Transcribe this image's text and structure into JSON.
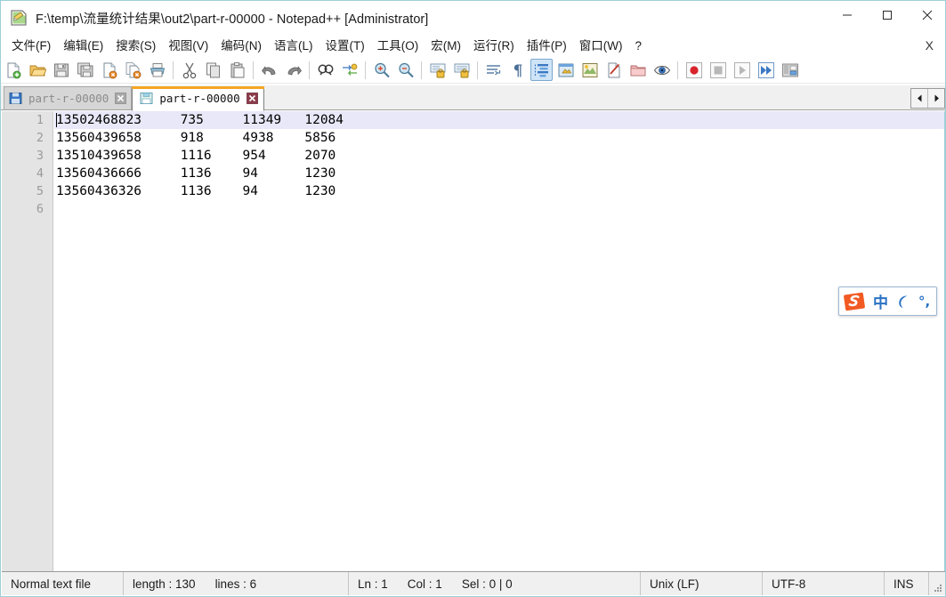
{
  "window": {
    "title": "F:\\temp\\流量统计结果\\out2\\part-r-00000 - Notepad++ [Administrator]",
    "icon": "notepad-plus-plus-icon",
    "controls": {
      "minimize": "–",
      "maximize": "□",
      "close": "✕"
    }
  },
  "menubar": {
    "items": [
      {
        "label": "文件(F)",
        "name": "menu-file"
      },
      {
        "label": "编辑(E)",
        "name": "menu-edit"
      },
      {
        "label": "搜索(S)",
        "name": "menu-search"
      },
      {
        "label": "视图(V)",
        "name": "menu-view"
      },
      {
        "label": "编码(N)",
        "name": "menu-encoding"
      },
      {
        "label": "语言(L)",
        "name": "menu-language"
      },
      {
        "label": "设置(T)",
        "name": "menu-settings"
      },
      {
        "label": "工具(O)",
        "name": "menu-tools"
      },
      {
        "label": "宏(M)",
        "name": "menu-macro"
      },
      {
        "label": "运行(R)",
        "name": "menu-run"
      },
      {
        "label": "插件(P)",
        "name": "menu-plugins"
      },
      {
        "label": "窗口(W)",
        "name": "menu-window"
      },
      {
        "label": "?",
        "name": "menu-help"
      }
    ],
    "document_close_label": "X"
  },
  "toolbar": {
    "buttons": [
      {
        "name": "new-file-icon",
        "title": "新建"
      },
      {
        "name": "open-file-icon",
        "title": "打开"
      },
      {
        "name": "save-icon",
        "title": "保存"
      },
      {
        "name": "save-all-icon",
        "title": "保存所有"
      },
      {
        "name": "close-file-icon",
        "title": "关闭"
      },
      {
        "name": "close-all-icon",
        "title": "关闭所有"
      },
      {
        "name": "print-icon",
        "title": "打印"
      },
      {
        "name": "separator-1",
        "sep": true
      },
      {
        "name": "cut-icon",
        "title": "剪切"
      },
      {
        "name": "copy-icon",
        "title": "复制"
      },
      {
        "name": "paste-icon",
        "title": "粘贴"
      },
      {
        "name": "separator-2",
        "sep": true
      },
      {
        "name": "undo-icon",
        "title": "撤销"
      },
      {
        "name": "redo-icon",
        "title": "重做"
      },
      {
        "name": "separator-3",
        "sep": true
      },
      {
        "name": "find-icon",
        "title": "查找"
      },
      {
        "name": "replace-icon",
        "title": "替换"
      },
      {
        "name": "separator-4",
        "sep": true
      },
      {
        "name": "zoom-in-icon",
        "title": "放大"
      },
      {
        "name": "zoom-out-icon",
        "title": "缩小"
      },
      {
        "name": "separator-5",
        "sep": true
      },
      {
        "name": "sync-vertical-scroll-icon",
        "title": "垂直同步滚动"
      },
      {
        "name": "sync-horizontal-scroll-icon",
        "title": "水平同步滚动"
      },
      {
        "name": "separator-6",
        "sep": true
      },
      {
        "name": "word-wrap-icon",
        "title": "自动换行"
      },
      {
        "name": "show-all-chars-icon",
        "title": "显示所有字符"
      },
      {
        "name": "indent-guide-icon",
        "title": "显示缩进参考线",
        "pressed": true
      },
      {
        "name": "user-defined-dialog-icon",
        "title": "用户自定义语言对话框"
      },
      {
        "name": "show-doc-map-icon",
        "title": "显示文档地图"
      },
      {
        "name": "show-func-list-icon",
        "title": "显示函数列表"
      },
      {
        "name": "show-folder-panel-icon",
        "title": "显示文件夹面板"
      },
      {
        "name": "monitor-icon",
        "title": "监视文件"
      },
      {
        "name": "separator-7",
        "sep": true
      },
      {
        "name": "record-macro-icon",
        "title": "开始录制宏"
      },
      {
        "name": "stop-macro-icon",
        "title": "停止录制宏"
      },
      {
        "name": "play-macro-icon",
        "title": "播放宏"
      },
      {
        "name": "run-macro-multiple-icon",
        "title": "多次运行宏"
      },
      {
        "name": "save-macro-icon",
        "title": "保存当前宏"
      }
    ]
  },
  "tabs": [
    {
      "label": "part-r-00000",
      "active": false,
      "icon": "saved-file-icon",
      "close": "✕"
    },
    {
      "label": "part-r-00000",
      "active": true,
      "icon": "saved-file-icon",
      "close": "✕"
    }
  ],
  "tab_scrollers": {
    "left": "◀",
    "right": "▶"
  },
  "editor": {
    "line_numbers": [
      "1",
      "2",
      "3",
      "4",
      "5",
      "6"
    ],
    "current_line": 1,
    "lines": [
      "13502468823\t735\t11349\t12084",
      "13560439658\t918\t4938\t5856",
      "13510439658\t1116\t954\t2070",
      "13560436666\t1136\t94\t1230",
      "13560436326\t1136\t94\t1230",
      ""
    ]
  },
  "ime": {
    "logo": "sogou-logo-icon",
    "mode": "中",
    "moon": "moon-icon",
    "punctuation": "°,"
  },
  "statusbar": {
    "file_type": "Normal text file",
    "length_label": "length : 130",
    "lines_label": "lines : 6",
    "ln_label": "Ln : 1",
    "col_label": "Col : 1",
    "sel_label": "Sel : 0 | 0",
    "eol": "Unix (LF)",
    "encoding": "UTF-8",
    "insert_mode": "INS"
  },
  "colors": {
    "accent_orange": "#f5a623",
    "window_border": "#9ecfd8",
    "current_line": "#e8e8f8",
    "gutter": "#e4e4e4",
    "ime_blue": "#2a72c4",
    "sogou_orange": "#f15a22"
  }
}
